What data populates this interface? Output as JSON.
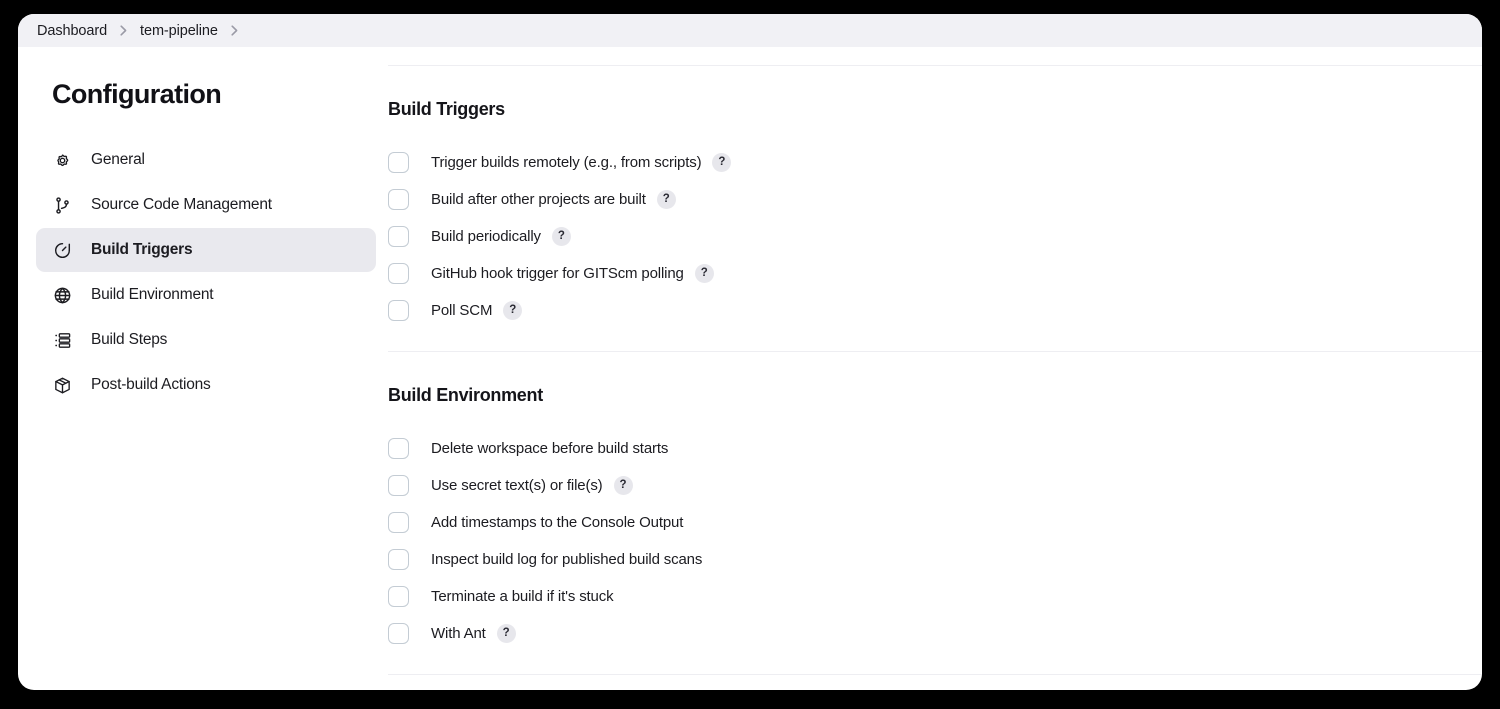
{
  "breadcrumb": {
    "items": [
      {
        "label": "Dashboard"
      },
      {
        "label": "tem-pipeline"
      }
    ],
    "separator_icon": "chevron-right-icon"
  },
  "sidebar": {
    "title": "Configuration",
    "items": [
      {
        "label": "General",
        "icon": "gear-icon",
        "active": false
      },
      {
        "label": "Source Code Management",
        "icon": "git-branch-icon",
        "active": false
      },
      {
        "label": "Build Triggers",
        "icon": "clock-timer-icon",
        "active": true
      },
      {
        "label": "Build Environment",
        "icon": "globe-icon",
        "active": false
      },
      {
        "label": "Build Steps",
        "icon": "list-icon",
        "active": false
      },
      {
        "label": "Post-build Actions",
        "icon": "package-box-icon",
        "active": false
      }
    ]
  },
  "main": {
    "sections": [
      {
        "title": "Build Triggers",
        "options": [
          {
            "label": "Trigger builds remotely (e.g., from scripts)",
            "checked": false,
            "help": "?"
          },
          {
            "label": "Build after other projects are built",
            "checked": false,
            "help": "?"
          },
          {
            "label": "Build periodically",
            "checked": false,
            "help": "?"
          },
          {
            "label": "GitHub hook trigger for GITScm polling",
            "checked": false,
            "help": "?"
          },
          {
            "label": "Poll SCM",
            "checked": false,
            "help": "?"
          }
        ]
      },
      {
        "title": "Build Environment",
        "options": [
          {
            "label": "Delete workspace before build starts",
            "checked": false,
            "help": ""
          },
          {
            "label": "Use secret text(s) or file(s)",
            "checked": false,
            "help": "?"
          },
          {
            "label": "Add timestamps to the Console Output",
            "checked": false,
            "help": ""
          },
          {
            "label": "Inspect build log for published build scans",
            "checked": false,
            "help": ""
          },
          {
            "label": "Terminate a build if it's stuck",
            "checked": false,
            "help": ""
          },
          {
            "label": "With Ant",
            "checked": false,
            "help": "?"
          }
        ]
      }
    ]
  },
  "colors": {
    "page_background": "#000000",
    "window_background": "#ffffff",
    "breadcrumb_background": "#f1f1f5",
    "active_nav_background": "#e9e9ee",
    "divider": "#eeeef2",
    "checkbox_border": "#c4ccd4",
    "help_badge_background": "#e7e7ec",
    "text_primary": "#1c1c21",
    "text_muted": "#9a9aa6"
  }
}
